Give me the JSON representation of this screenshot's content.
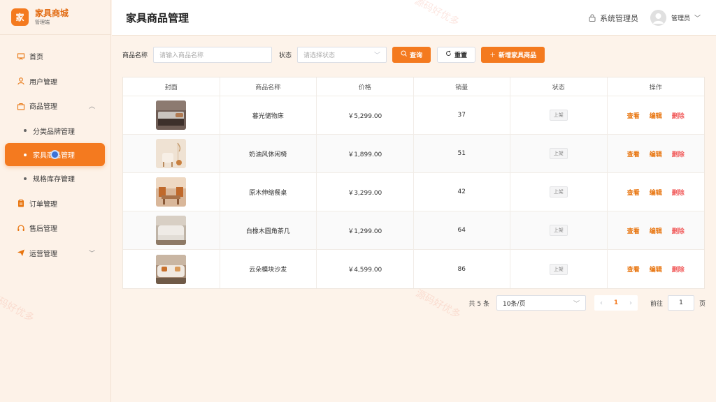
{
  "brand": {
    "logo_char": "家",
    "name": "家具商城",
    "sub": "管理端"
  },
  "header": {
    "title": "家具商品管理",
    "role": "系统管理员",
    "user": "管理员"
  },
  "sidebar": {
    "items": [
      {
        "label": "首页"
      },
      {
        "label": "用户管理"
      },
      {
        "label": "商品管理",
        "expanded": true
      },
      {
        "label": "订单管理"
      },
      {
        "label": "售后管理"
      },
      {
        "label": "运营管理"
      }
    ],
    "subitems": [
      {
        "label": "分类品牌管理"
      },
      {
        "label": "家具商品管理",
        "active": true
      },
      {
        "label": "规格库存管理"
      }
    ]
  },
  "filters": {
    "name_label": "商品名称",
    "name_placeholder": "请输入商品名称",
    "status_label": "状态",
    "status_placeholder": "请选择状态",
    "search_btn": "查询",
    "reset_btn": "重置",
    "add_btn": "新增家具商品"
  },
  "table": {
    "headers": [
      "封面",
      "商品名称",
      "价格",
      "销量",
      "状态",
      "操作"
    ],
    "rows": [
      {
        "name": "暮光储物床",
        "price": "￥5,299.00",
        "sales": "37",
        "status": "上架"
      },
      {
        "name": "奶油风休闲椅",
        "price": "￥1,899.00",
        "sales": "51",
        "status": "上架"
      },
      {
        "name": "原木伸缩餐桌",
        "price": "￥3,299.00",
        "sales": "42",
        "status": "上架"
      },
      {
        "name": "白橡木圆角茶几",
        "price": "￥1,299.00",
        "sales": "64",
        "status": "上架"
      },
      {
        "name": "云朵模块沙发",
        "price": "￥4,599.00",
        "sales": "86",
        "status": "上架"
      }
    ],
    "ops": {
      "view": "查看",
      "edit": "编辑",
      "delete": "删除"
    }
  },
  "pager": {
    "total": "共 5 条",
    "size": "10条/页",
    "current": "1",
    "goto_label": "前往",
    "goto_value": "1",
    "page_unit": "页"
  },
  "watermark": "源码好优多",
  "colors": {
    "accent": "#f47a1f",
    "danger": "#f15a5a",
    "bg": "#fdf3ea"
  }
}
